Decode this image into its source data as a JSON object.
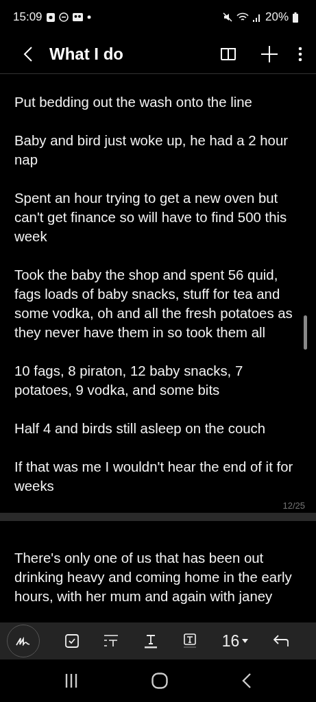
{
  "status_bar": {
    "time": "15:09",
    "battery": "20%"
  },
  "header": {
    "title": "What I do"
  },
  "pages": [
    {
      "paragraphs": [
        "Put bedding out the wash onto the line",
        "Baby and bird just woke up, he had a 2 hour nap",
        "Spent an hour trying to get a new oven but can't get finance so will have to find 500 this week",
        "Took the baby the shop and spent 56 quid, fags loads of baby snacks, stuff for tea and some vodka, oh and all the fresh potatoes as they never have them in so took them all",
        "10 fags, 8 piraton, 12 baby snacks, 7 potatoes, 9 vodka, and some bits",
        "Half 4 and birds still asleep on the couch",
        "If that was me I wouldn't hear the end of it for weeks"
      ],
      "page_number": "12/25"
    },
    {
      "paragraphs": [
        "There's only one of us that has been out drinking heavy and coming home in the early hours, with her mum and again with janey"
      ]
    }
  ],
  "toolbar": {
    "font_size": "16"
  }
}
